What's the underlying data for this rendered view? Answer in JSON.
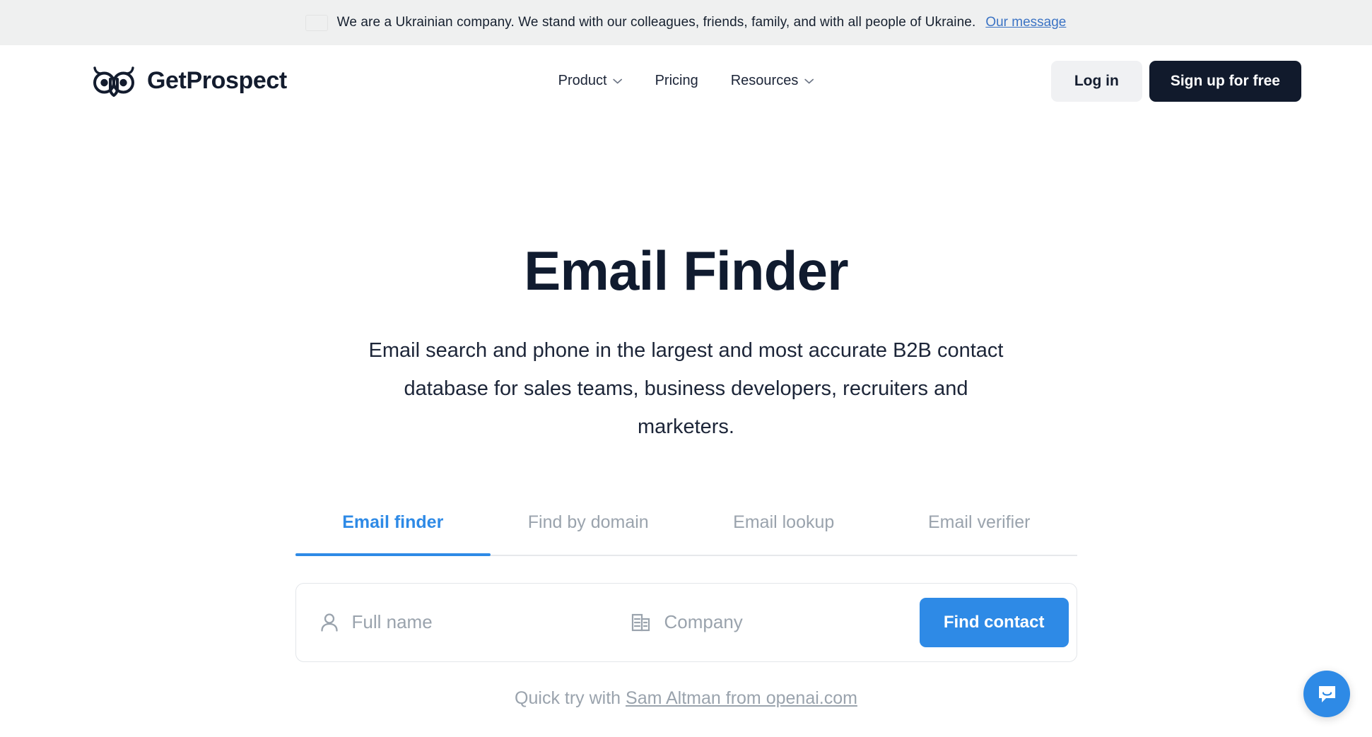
{
  "banner": {
    "flag_icon": "ukraine-flag-icon",
    "text": "We are a Ukrainian company. We stand with our colleagues, friends, family, and with all people of Ukraine.",
    "link_label": "Our message",
    "background_color": "#eff0f0",
    "link_color": "#3b73c4",
    "flag_blue": "#2189e0",
    "flag_yellow": "#f5b417"
  },
  "header": {
    "logo": {
      "icon": "owl-logo-icon",
      "wordmark": "GetProspect",
      "color": "#131c2e"
    },
    "nav": [
      {
        "label": "Product",
        "has_dropdown": true,
        "icon": "chevron-down-icon"
      },
      {
        "label": "Pricing",
        "has_dropdown": false
      },
      {
        "label": "Resources",
        "has_dropdown": true,
        "icon": "chevron-down-icon"
      }
    ],
    "login_label": "Log in",
    "signup_label": "Sign up for free",
    "login_bg": "#f0f1f3",
    "signup_bg": "#111a2c"
  },
  "hero": {
    "title": "Email Finder",
    "subtitle": "Email search and phone in the largest and most accurate B2B contact database for sales teams, business developers, recruiters and marketers."
  },
  "tabs": {
    "active_index": 0,
    "accent_color": "#2e8ae6",
    "items": [
      {
        "label": "Email finder"
      },
      {
        "label": "Find by domain"
      },
      {
        "label": "Email lookup"
      },
      {
        "label": "Email verifier"
      }
    ]
  },
  "search": {
    "name_icon": "person-icon",
    "name_placeholder": "Full name",
    "name_value": "",
    "company_icon": "building-icon",
    "company_placeholder": "Company",
    "company_value": "",
    "submit_label": "Find contact",
    "submit_color": "#2e8ae6"
  },
  "quick_try": {
    "prefix": "Quick try with ",
    "link_label": "Sam Altman from openai.com"
  },
  "chat": {
    "icon": "chat-bubble-icon",
    "color": "#2e8ae6"
  }
}
